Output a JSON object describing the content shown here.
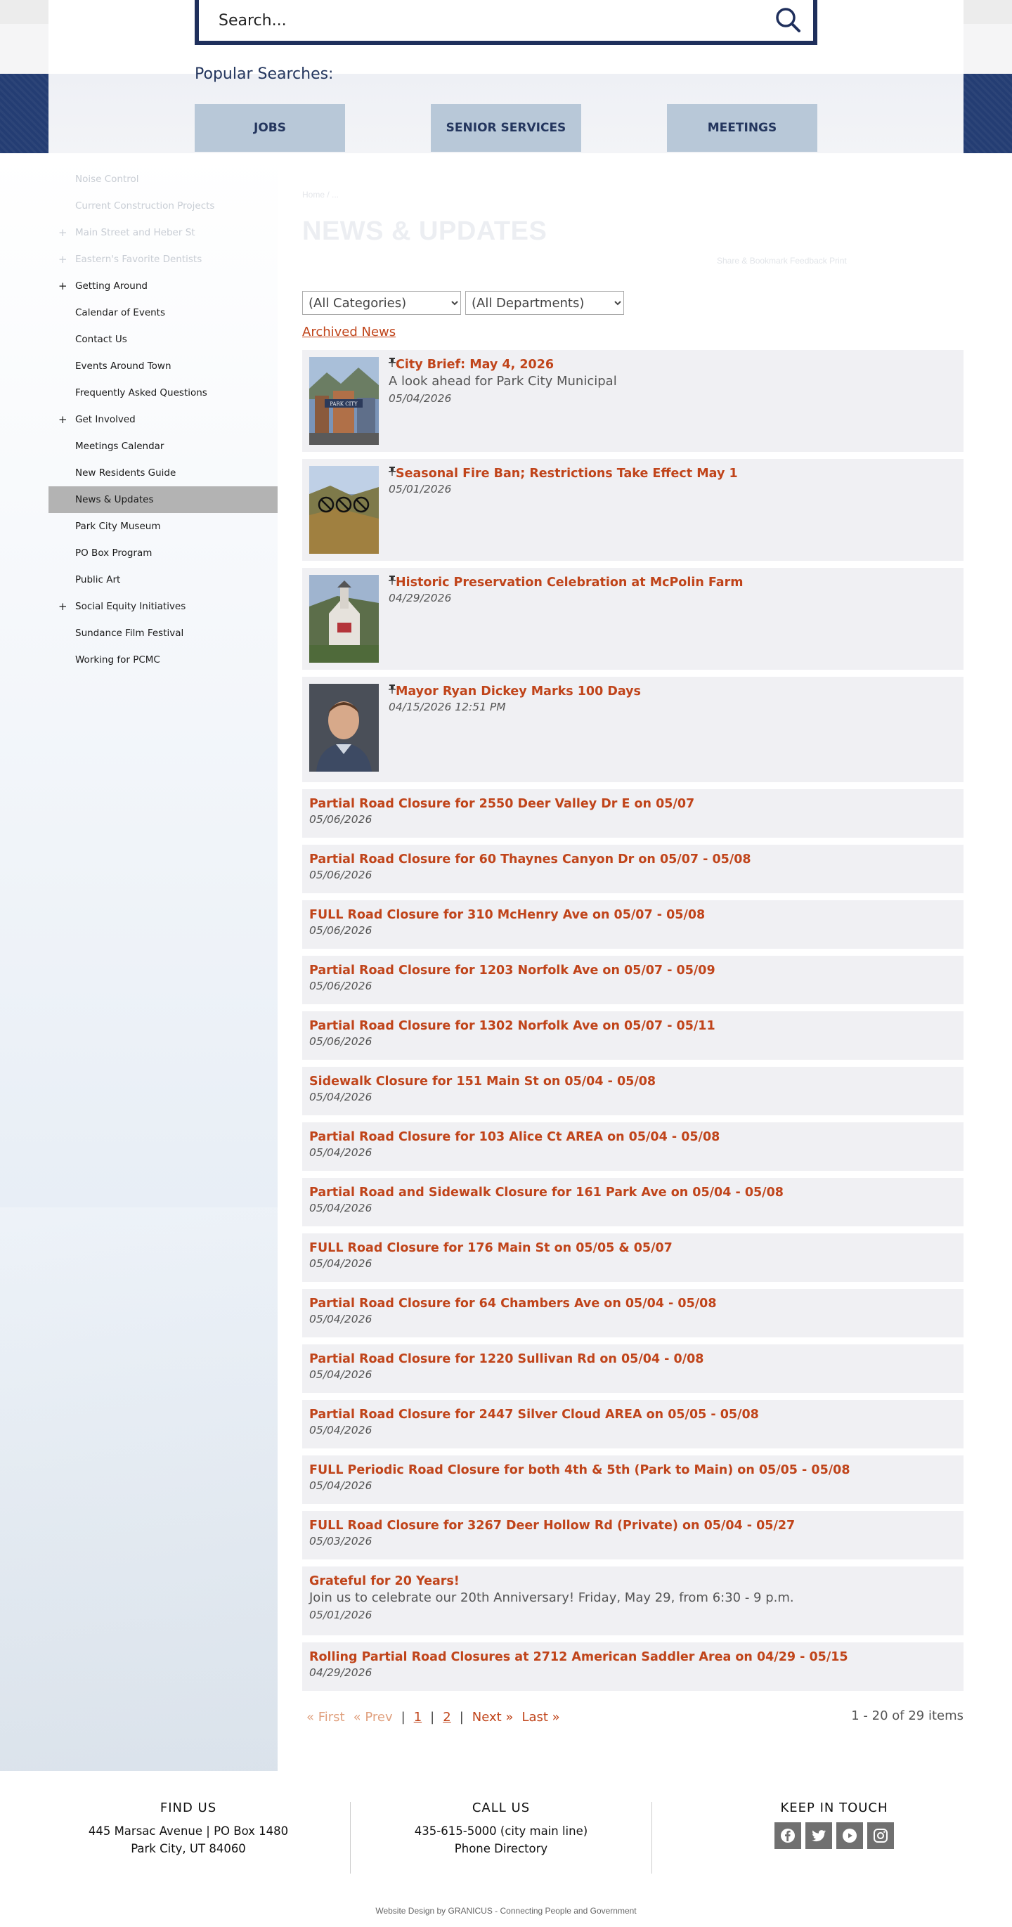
{
  "search": {
    "placeholder": "Search..."
  },
  "popular": {
    "title": "Popular Searches:",
    "buttons": [
      "JOBS",
      "SENIOR SERVICES",
      "MEETINGS"
    ]
  },
  "sidebar": {
    "items": [
      {
        "label": "Noise Control",
        "faded": true,
        "plus": false
      },
      {
        "label": "Current Construction Projects",
        "faded": true,
        "plus": false
      },
      {
        "label": "Main Street and Heber St",
        "faded": true,
        "plus": true
      },
      {
        "label": "Eastern's Favorite Dentists",
        "faded": true,
        "plus": true
      },
      {
        "label": "Getting Around",
        "plus": true
      },
      {
        "label": "Calendar of Events"
      },
      {
        "label": "Contact Us"
      },
      {
        "label": "Events Around Town"
      },
      {
        "label": "Frequently Asked Questions"
      },
      {
        "label": "Get Involved",
        "plus": true
      },
      {
        "label": "Meetings Calendar"
      },
      {
        "label": "New Residents Guide"
      },
      {
        "label": "News & Updates",
        "active": true
      },
      {
        "label": "Park City Museum"
      },
      {
        "label": "PO Box Program"
      },
      {
        "label": "Public Art"
      },
      {
        "label": "Social Equity Initiatives",
        "plus": true
      },
      {
        "label": "Sundance Film Festival"
      },
      {
        "label": "Working for PCMC"
      }
    ]
  },
  "main": {
    "breadcrumb": "Home / ...",
    "title": "NEWS & UPDATES",
    "tools": "Share & Bookmark   Feedback   Print",
    "filters": {
      "category": "(All Categories)",
      "department": "(All Departments)"
    },
    "archived": "Archived News",
    "featured": [
      {
        "title": "City Brief: May 4, 2026",
        "desc": "A look ahead for Park City Municipal",
        "date": "05/04/2026",
        "thumb": "town"
      },
      {
        "title": "Seasonal Fire Ban; Restrictions Take Effect May 1",
        "desc": "",
        "date": "05/01/2026",
        "thumb": "fire"
      },
      {
        "title": "Historic Preservation Celebration at McPolin Farm",
        "desc": "",
        "date": "04/29/2026",
        "thumb": "barn"
      },
      {
        "title": "Mayor Ryan Dickey Marks 100 Days",
        "desc": "",
        "date": "04/15/2026 12:51 PM",
        "thumb": "portrait"
      }
    ],
    "items": [
      {
        "title": "Partial Road Closure for 2550 Deer Valley Dr E on 05/07",
        "date": "05/06/2026"
      },
      {
        "title": "Partial Road Closure for 60 Thaynes Canyon Dr on 05/07 - 05/08",
        "date": "05/06/2026"
      },
      {
        "title": "FULL Road Closure for 310 McHenry Ave on 05/07 - 05/08",
        "date": "05/06/2026"
      },
      {
        "title": "Partial Road Closure for 1203 Norfolk Ave on 05/07 - 05/09",
        "date": "05/06/2026"
      },
      {
        "title": "Partial Road Closure for 1302 Norfolk Ave on 05/07 - 05/11",
        "date": "05/06/2026"
      },
      {
        "title": "Sidewalk Closure for 151 Main St on 05/04 - 05/08",
        "date": "05/04/2026"
      },
      {
        "title": "Partial Road Closure for 103 Alice Ct AREA on 05/04 - 05/08",
        "date": "05/04/2026"
      },
      {
        "title": "Partial Road and Sidewalk Closure for 161 Park Ave on 05/04 - 05/08",
        "date": "05/04/2026"
      },
      {
        "title": "FULL Road Closure for 176 Main St on 05/05 & 05/07",
        "date": "05/04/2026"
      },
      {
        "title": "Partial Road Closure for 64 Chambers Ave on 05/04 - 05/08",
        "date": "05/04/2026"
      },
      {
        "title": "Partial Road Closure for 1220 Sullivan Rd on 05/04 - 0/08",
        "date": "05/04/2026"
      },
      {
        "title": "Partial Road Closure for 2447 Silver Cloud AREA on 05/05 - 05/08",
        "date": "05/04/2026"
      },
      {
        "title": "FULL Periodic Road Closure for both 4th & 5th (Park to Main) on 05/05 - 05/08",
        "date": "05/04/2026"
      },
      {
        "title": "FULL Road Closure for 3267 Deer Hollow Rd (Private) on 05/04 - 05/27",
        "date": "05/03/2026"
      },
      {
        "title": "Grateful for 20 Years!",
        "desc": "Join us to celebrate our 20th Anniversary! Friday, May 29, from 6:30 - 9 p.m.",
        "date": "05/01/2026"
      },
      {
        "title": "Rolling Partial Road Closures at 2712 American Saddler Area on 04/29 - 05/15",
        "date": "04/29/2026"
      }
    ],
    "pager": {
      "first": "« First",
      "prev": "« Prev",
      "page1": "1",
      "page2": "2",
      "next": "Next »",
      "last": "Last »",
      "sep": "|"
    },
    "count": "1 - 20 of 29 items"
  },
  "footer": {
    "find": {
      "title": "FIND US",
      "line1": "445 Marsac Avenue | PO Box 1480",
      "line2": "Park City, UT 84060"
    },
    "call": {
      "title": "CALL US",
      "line1": "435-615-5000 (city main line)",
      "line2": "Phone Directory"
    },
    "keep": {
      "title": "KEEP IN TOUCH",
      "icons": [
        "facebook-icon",
        "twitter-icon",
        "youtube-icon",
        "instagram-icon"
      ]
    },
    "credit": "Website Design by GRANICUS - Connecting People and Government"
  }
}
